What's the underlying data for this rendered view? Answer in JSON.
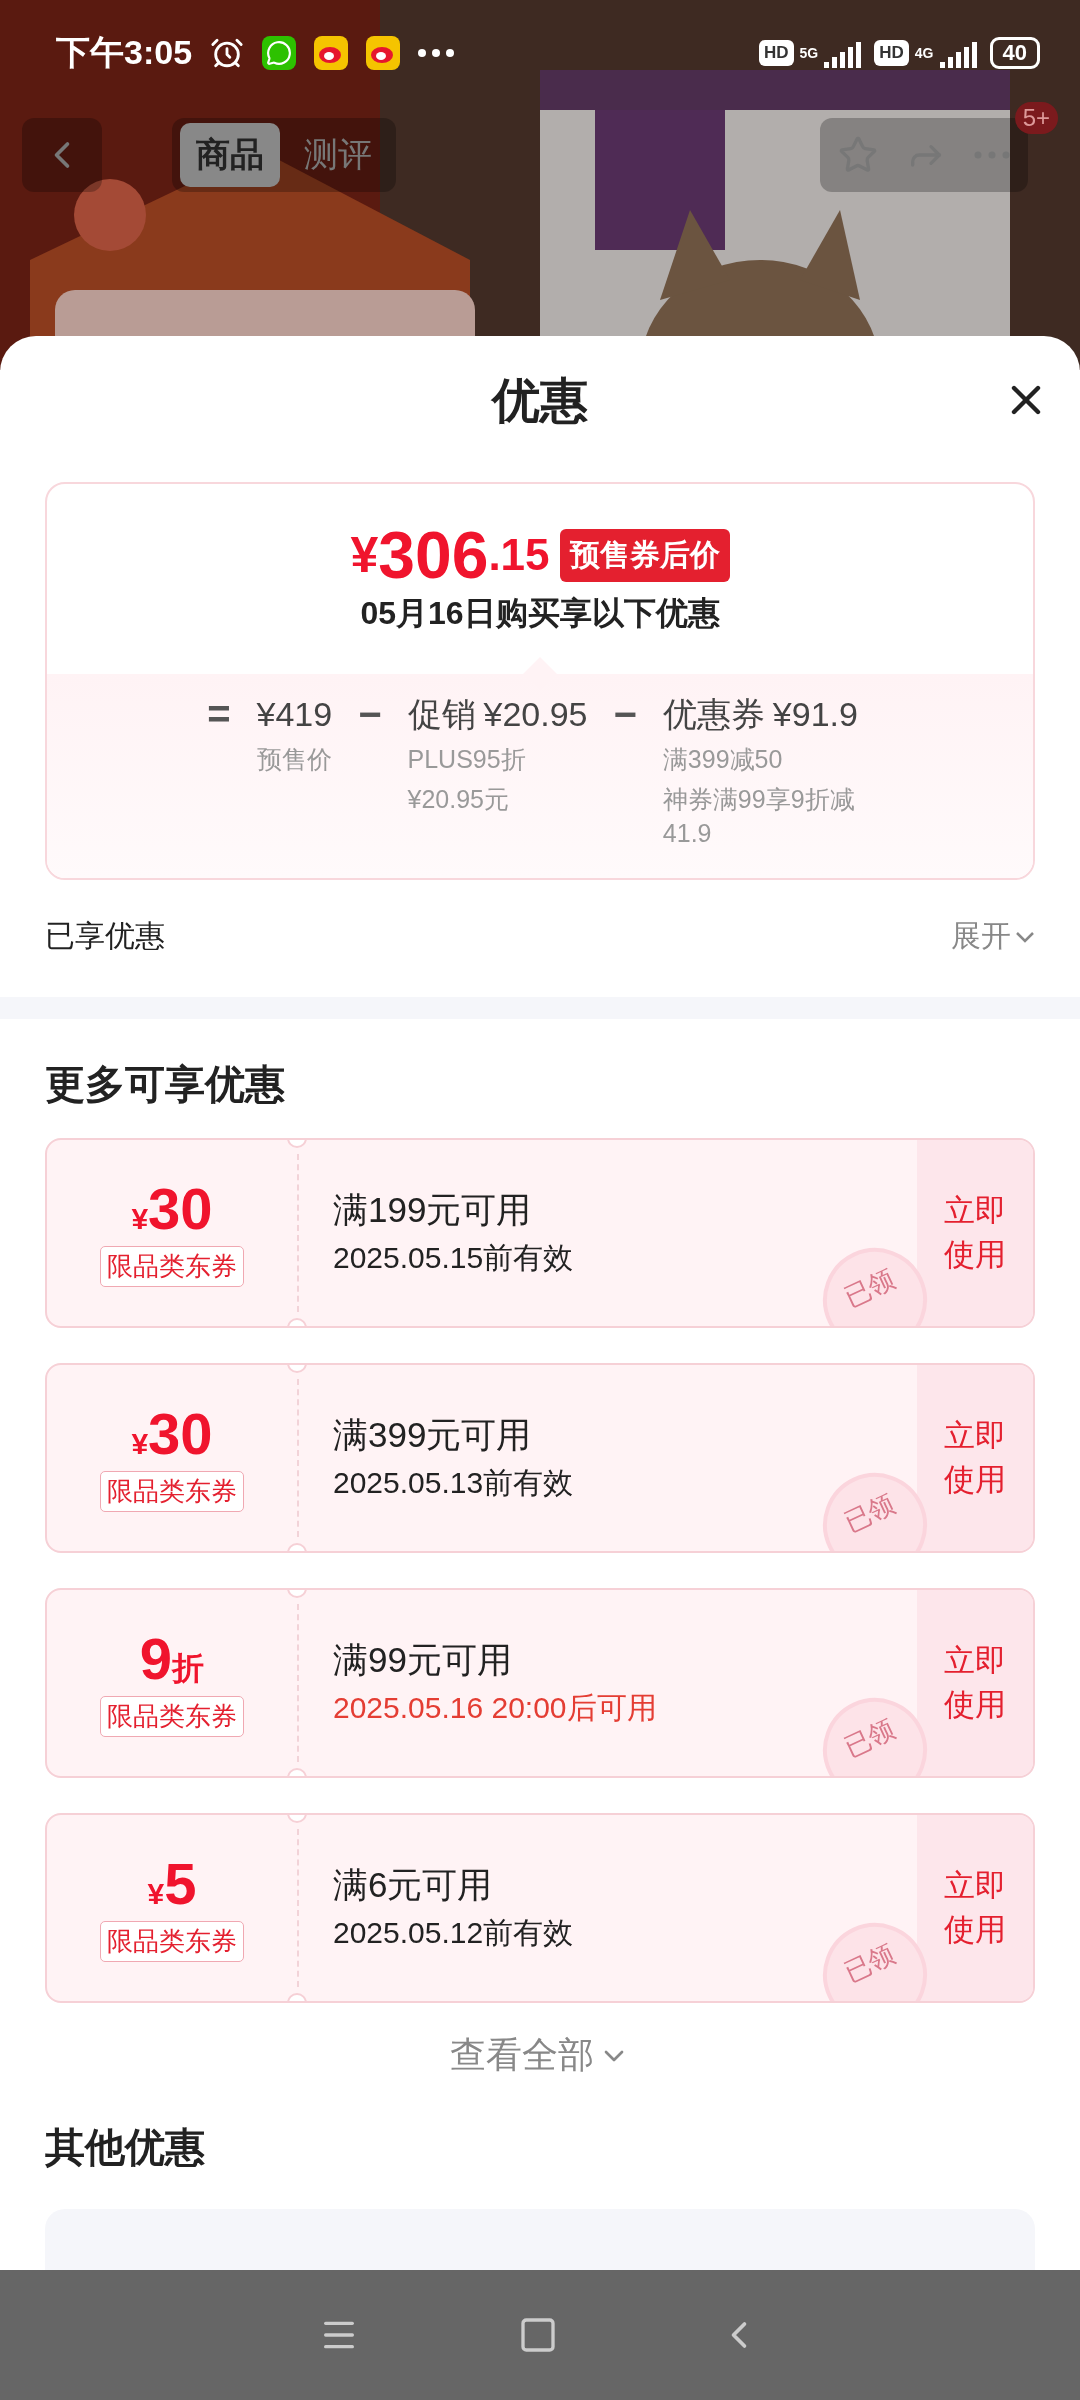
{
  "status_bar": {
    "time": "下午3:05",
    "network_1": {
      "hd": "HD",
      "type": "5G"
    },
    "network_2": {
      "hd": "HD",
      "type": "4G"
    },
    "battery": "40"
  },
  "top_nav": {
    "tabs": [
      {
        "label": "商品",
        "selected": true
      },
      {
        "label": "测评",
        "selected": false
      }
    ],
    "badge": "5+"
  },
  "sheet": {
    "title": "优惠",
    "price_card": {
      "currency": "¥",
      "price_int": "306",
      "price_dec": ".15",
      "badge": "预售券后价",
      "subtitle": "05月16日购买享以下优惠",
      "breakdown": [
        {
          "operator": "=",
          "amount": "¥419",
          "notes": [
            "预售价"
          ]
        },
        {
          "operator": "−",
          "title": "促销",
          "amount": "¥20.95",
          "notes": [
            "PLUS95折",
            "¥20.95元"
          ]
        },
        {
          "operator": "−",
          "title": "优惠券",
          "amount": "¥91.9",
          "notes": [
            "满399减50",
            "神券满99享9折减41.9"
          ]
        }
      ]
    },
    "enjoyed": {
      "label": "已享优惠",
      "toggle": "展开"
    },
    "more_title": "更多可享优惠",
    "coupons": [
      {
        "kind": "cash",
        "symbol": "¥",
        "value": "30",
        "tag": "限品类东券",
        "condition": "满199元可用",
        "validity": "2025.05.15前有效",
        "highlighted": false,
        "action": "立即使用",
        "stamp": "已领"
      },
      {
        "kind": "cash",
        "symbol": "¥",
        "value": "30",
        "tag": "限品类东券",
        "condition": "满399元可用",
        "validity": "2025.05.13前有效",
        "highlighted": false,
        "action": "立即使用",
        "stamp": "已领"
      },
      {
        "kind": "discount",
        "symbol": "折",
        "value": "9",
        "tag": "限品类东券",
        "condition": "满99元可用",
        "validity": "2025.05.16 20:00后可用",
        "highlighted": true,
        "action": "立即使用",
        "stamp": "已领"
      },
      {
        "kind": "cash",
        "symbol": "¥",
        "value": "5",
        "tag": "限品类东券",
        "condition": "满6元可用",
        "validity": "2025.05.12前有效",
        "highlighted": false,
        "action": "立即使用",
        "stamp": "已领"
      }
    ],
    "view_all": "查看全部",
    "other_title": "其他优惠"
  }
}
